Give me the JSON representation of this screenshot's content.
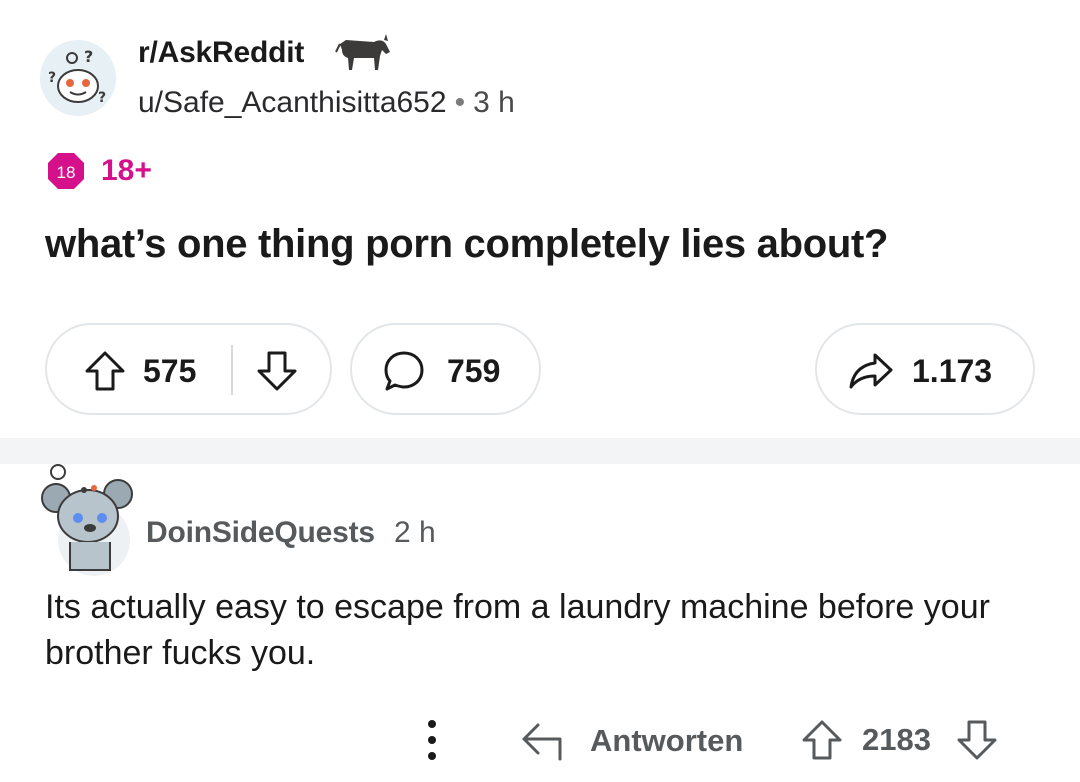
{
  "post": {
    "subreddit": "r/AskReddit",
    "author": "u/Safe_Acanthisitta652",
    "separator": "•",
    "time": "3 h",
    "nsfw_badge": "18",
    "nsfw_label": "18+",
    "title": "what’s one thing porn completely lies about?",
    "upvotes": "575",
    "comments": "759",
    "shares": "1.173",
    "icons": {
      "subreddit_avatar": "askreddit-snoo-icon",
      "flair": "donkey-icon",
      "upvote": "arrow-up-icon",
      "downvote": "arrow-down-icon",
      "comment": "comment-bubble-icon",
      "share": "share-arrow-icon"
    }
  },
  "comment": {
    "author": "DoinSideQuests",
    "time": "2 h",
    "body": "Its actually easy to escape from a laundry machine before your brother fucks you.",
    "reply_label": "Antworten",
    "score": "2183",
    "icons": {
      "avatar": "koala-avatar-icon",
      "more": "more-vertical-icon",
      "reply": "reply-arrow-icon",
      "upvote": "arrow-up-icon",
      "downvote": "arrow-down-icon"
    }
  },
  "colors": {
    "nsfw": "#d4118a",
    "text": "#1a1a1b",
    "muted": "#575a5c",
    "border": "#e3e6e8",
    "divider": "#f3f4f6"
  }
}
